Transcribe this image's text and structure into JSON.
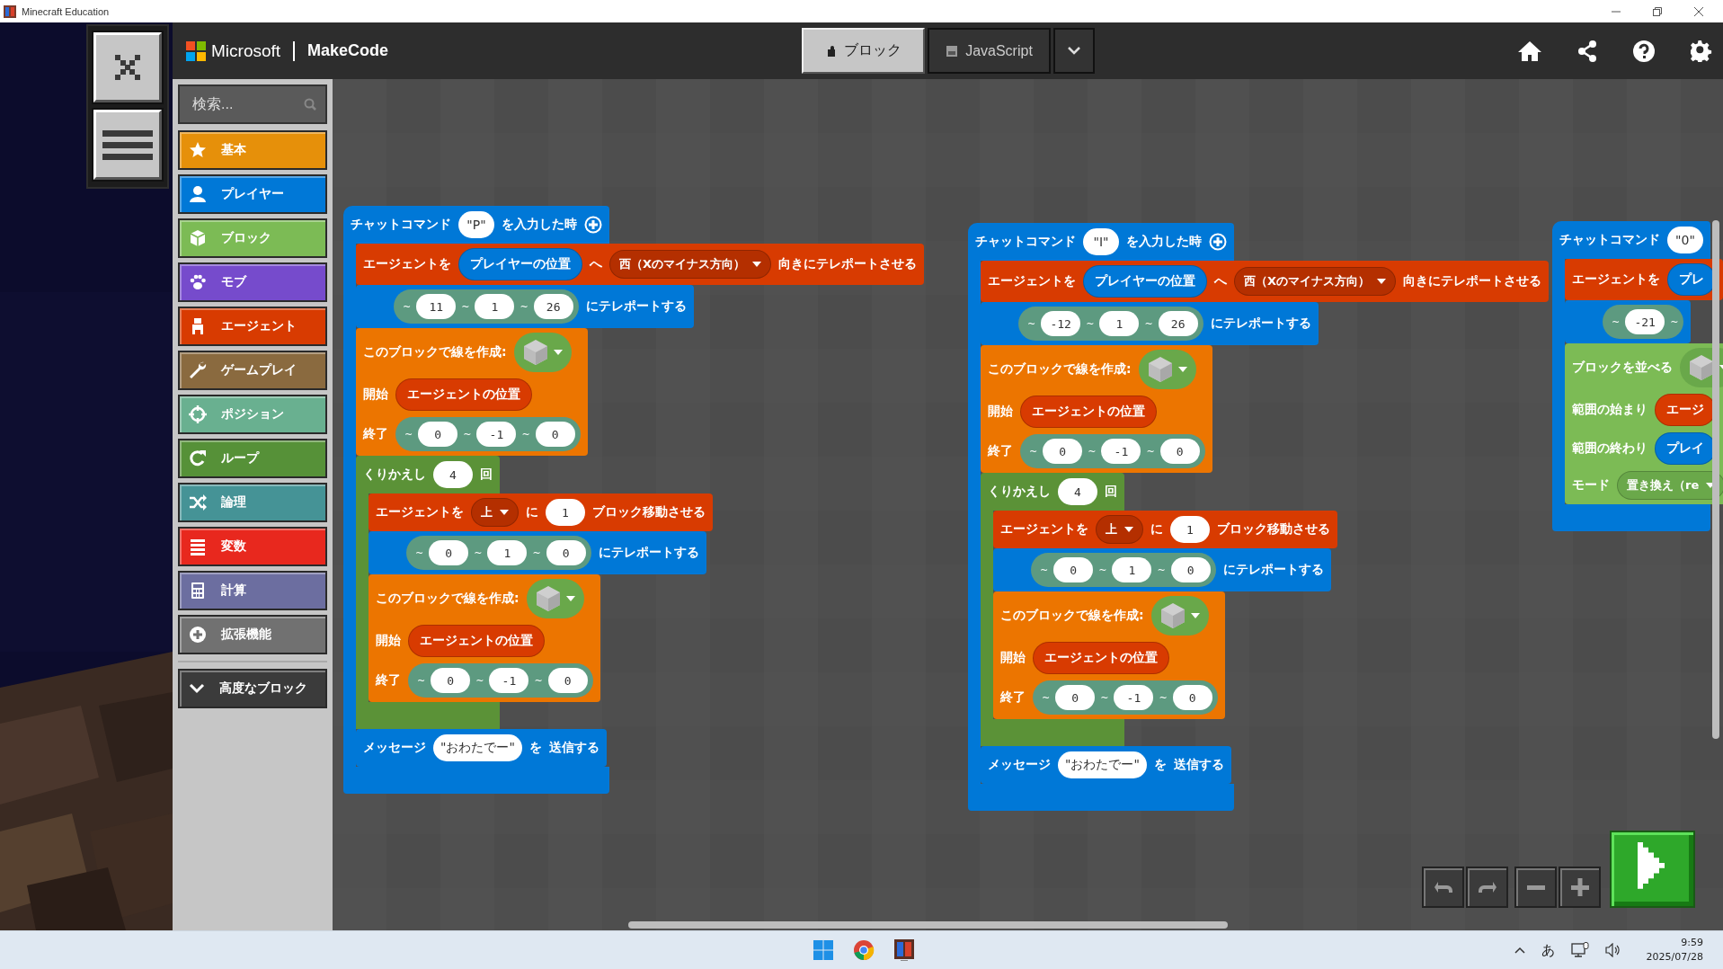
{
  "window": {
    "title": "Minecraft Education"
  },
  "header": {
    "brand": "Microsoft",
    "product": "MakeCode",
    "tabs": [
      {
        "label": "ブロック",
        "selected": true
      },
      {
        "label": "JavaScript",
        "selected": false
      }
    ]
  },
  "toolbox": {
    "search": {
      "placeholder": "検索..."
    },
    "categories": [
      {
        "label": "基本",
        "color": "#e6900a"
      },
      {
        "label": "プレイヤー",
        "color": "#0078d7"
      },
      {
        "label": "ブロック",
        "color": "#7cbb55"
      },
      {
        "label": "モブ",
        "color": "#764bcc"
      },
      {
        "label": "エージェント",
        "color": "#d83b01"
      },
      {
        "label": "ゲームプレイ",
        "color": "#8a6a3f"
      },
      {
        "label": "ポジション",
        "color": "#69b090"
      },
      {
        "label": "ループ",
        "color": "#569138"
      },
      {
        "label": "論理",
        "color": "#459396"
      },
      {
        "label": "変数",
        "color": "#e8281e"
      },
      {
        "label": "計算",
        "color": "#6c6ea0"
      },
      {
        "label": "拡張機能",
        "color": "#717171"
      }
    ],
    "advanced": {
      "label": "高度なブロック"
    }
  },
  "scripts": [
    {
      "kind": "event",
      "color": "#0078d7",
      "rows": [
        [
          {
            "kind": "text",
            "text": "チャットコマンド"
          },
          {
            "kind": "string",
            "text": "\"P\""
          },
          {
            "kind": "text",
            "text": "を入力した時"
          },
          {
            "kind": "plus"
          }
        ]
      ],
      "body": [
        {
          "kind": "statement",
          "color": "#d83b01",
          "rows": [
            [
              {
                "kind": "text",
                "text": "エージェントを"
              },
              {
                "kind": "pill",
                "color": "#0078d7",
                "text": "プレイヤーの位置"
              },
              {
                "kind": "text",
                "text": "へ"
              },
              {
                "kind": "dropdown",
                "color": "#b42f00",
                "text": "西（Xのマイナス方向）"
              },
              {
                "kind": "text",
                "text": "向きにテレポートさせる"
              }
            ]
          ]
        },
        {
          "kind": "statement",
          "color": "#0078d7",
          "rows": [
            [
              {
                "kind": "gap"
              },
              {
                "kind": "coords",
                "color": "#5d9a80",
                "parts": [
                  {
                    "kind": "tilde",
                    "text": "~"
                  },
                  {
                    "kind": "num",
                    "text": "11"
                  },
                  {
                    "kind": "tilde",
                    "text": "~"
                  },
                  {
                    "kind": "num",
                    "text": "1"
                  },
                  {
                    "kind": "tilde",
                    "text": "~"
                  },
                  {
                    "kind": "num",
                    "text": "26"
                  }
                ]
              },
              {
                "kind": "text",
                "text": "にテレポートする"
              }
            ]
          ]
        },
        {
          "kind": "statement",
          "color": "#ec7500",
          "rows": [
            [
              {
                "kind": "text",
                "text": "このブロックで線を作成:"
              },
              {
                "kind": "picker",
                "color": "#69a84a"
              }
            ],
            [
              {
                "kind": "text",
                "text": "開始"
              },
              {
                "kind": "pill",
                "color": "#d83b01",
                "text": "エージェントの位置"
              }
            ],
            [
              {
                "kind": "text",
                "text": "終了"
              },
              {
                "kind": "coords",
                "color": "#5d9a80",
                "parts": [
                  {
                    "kind": "tilde",
                    "text": "~"
                  },
                  {
                    "kind": "num",
                    "text": "0"
                  },
                  {
                    "kind": "tilde",
                    "text": "~"
                  },
                  {
                    "kind": "num",
                    "text": "-1"
                  },
                  {
                    "kind": "tilde",
                    "text": "~"
                  },
                  {
                    "kind": "num",
                    "text": "0"
                  }
                ]
              }
            ]
          ]
        },
        {
          "kind": "loop",
          "color": "#5b9237",
          "rows": [
            [
              {
                "kind": "text",
                "text": "くりかえし"
              },
              {
                "kind": "num",
                "text": "4"
              },
              {
                "kind": "text",
                "text": "回"
              }
            ]
          ],
          "body": [
            {
              "kind": "statement",
              "color": "#d83b01",
              "rows": [
                [
                  {
                    "kind": "text",
                    "text": "エージェントを"
                  },
                  {
                    "kind": "dropdown",
                    "color": "#b42f00",
                    "text": "上"
                  },
                  {
                    "kind": "text",
                    "text": "に"
                  },
                  {
                    "kind": "num",
                    "text": "1"
                  },
                  {
                    "kind": "text",
                    "text": "ブロック移動させる"
                  }
                ]
              ]
            },
            {
              "kind": "statement",
              "color": "#0078d7",
              "rows": [
                [
                  {
                    "kind": "gap"
                  },
                  {
                    "kind": "coords",
                    "color": "#5d9a80",
                    "parts": [
                      {
                        "kind": "tilde",
                        "text": "~"
                      },
                      {
                        "kind": "num",
                        "text": "0"
                      },
                      {
                        "kind": "tilde",
                        "text": "~"
                      },
                      {
                        "kind": "num",
                        "text": "1"
                      },
                      {
                        "kind": "tilde",
                        "text": "~"
                      },
                      {
                        "kind": "num",
                        "text": "0"
                      }
                    ]
                  },
                  {
                    "kind": "text",
                    "text": "にテレポートする"
                  }
                ]
              ]
            },
            {
              "kind": "statement",
              "color": "#ec7500",
              "rows": [
                [
                  {
                    "kind": "text",
                    "text": "このブロックで線を作成:"
                  },
                  {
                    "kind": "picker",
                    "color": "#69a84a"
                  }
                ],
                [
                  {
                    "kind": "text",
                    "text": "開始"
                  },
                  {
                    "kind": "pill",
                    "color": "#d83b01",
                    "text": "エージェントの位置"
                  }
                ],
                [
                  {
                    "kind": "text",
                    "text": "終了"
                  },
                  {
                    "kind": "coords",
                    "color": "#5d9a80",
                    "parts": [
                      {
                        "kind": "tilde",
                        "text": "~"
                      },
                      {
                        "kind": "num",
                        "text": "0"
                      },
                      {
                        "kind": "tilde",
                        "text": "~"
                      },
                      {
                        "kind": "num",
                        "text": "-1"
                      },
                      {
                        "kind": "tilde",
                        "text": "~"
                      },
                      {
                        "kind": "num",
                        "text": "0"
                      }
                    ]
                  }
                ]
              ]
            }
          ]
        },
        {
          "kind": "statement",
          "color": "#0078d7",
          "rows": [
            [
              {
                "kind": "text",
                "text": "メッセージ"
              },
              {
                "kind": "string",
                "text": "\"おわたでー\""
              },
              {
                "kind": "text",
                "text": "を"
              },
              {
                "kind": "text",
                "text": "送信する"
              }
            ]
          ]
        }
      ]
    },
    {
      "kind": "event",
      "color": "#0078d7",
      "rows": [
        [
          {
            "kind": "text",
            "text": "チャットコマンド"
          },
          {
            "kind": "string",
            "text": "\"I\""
          },
          {
            "kind": "text",
            "text": "を入力した時"
          },
          {
            "kind": "plus"
          }
        ]
      ],
      "body": [
        {
          "kind": "statement",
          "color": "#d83b01",
          "rows": [
            [
              {
                "kind": "text",
                "text": "エージェントを"
              },
              {
                "kind": "pill",
                "color": "#0078d7",
                "text": "プレイヤーの位置"
              },
              {
                "kind": "text",
                "text": "へ"
              },
              {
                "kind": "dropdown",
                "color": "#b42f00",
                "text": "西（Xのマイナス方向）"
              },
              {
                "kind": "text",
                "text": "向きにテレポートさせる"
              }
            ]
          ]
        },
        {
          "kind": "statement",
          "color": "#0078d7",
          "rows": [
            [
              {
                "kind": "gap"
              },
              {
                "kind": "coords",
                "color": "#5d9a80",
                "parts": [
                  {
                    "kind": "tilde",
                    "text": "~"
                  },
                  {
                    "kind": "num",
                    "text": "-12"
                  },
                  {
                    "kind": "tilde",
                    "text": "~"
                  },
                  {
                    "kind": "num",
                    "text": "1"
                  },
                  {
                    "kind": "tilde",
                    "text": "~"
                  },
                  {
                    "kind": "num",
                    "text": "26"
                  }
                ]
              },
              {
                "kind": "text",
                "text": "にテレポートする"
              }
            ]
          ]
        },
        {
          "kind": "statement",
          "color": "#ec7500",
          "rows": [
            [
              {
                "kind": "text",
                "text": "このブロックで線を作成:"
              },
              {
                "kind": "picker",
                "color": "#69a84a"
              }
            ],
            [
              {
                "kind": "text",
                "text": "開始"
              },
              {
                "kind": "pill",
                "color": "#d83b01",
                "text": "エージェントの位置"
              }
            ],
            [
              {
                "kind": "text",
                "text": "終了"
              },
              {
                "kind": "coords",
                "color": "#5d9a80",
                "parts": [
                  {
                    "kind": "tilde",
                    "text": "~"
                  },
                  {
                    "kind": "num",
                    "text": "0"
                  },
                  {
                    "kind": "tilde",
                    "text": "~"
                  },
                  {
                    "kind": "num",
                    "text": "-1"
                  },
                  {
                    "kind": "tilde",
                    "text": "~"
                  },
                  {
                    "kind": "num",
                    "text": "0"
                  }
                ]
              }
            ]
          ]
        },
        {
          "kind": "loop",
          "color": "#5b9237",
          "rows": [
            [
              {
                "kind": "text",
                "text": "くりかえし"
              },
              {
                "kind": "num",
                "text": "4"
              },
              {
                "kind": "text",
                "text": "回"
              }
            ]
          ],
          "body": [
            {
              "kind": "statement",
              "color": "#d83b01",
              "rows": [
                [
                  {
                    "kind": "text",
                    "text": "エージェントを"
                  },
                  {
                    "kind": "dropdown",
                    "color": "#b42f00",
                    "text": "上"
                  },
                  {
                    "kind": "text",
                    "text": "に"
                  },
                  {
                    "kind": "num",
                    "text": "1"
                  },
                  {
                    "kind": "text",
                    "text": "ブロック移動させる"
                  }
                ]
              ]
            },
            {
              "kind": "statement",
              "color": "#0078d7",
              "rows": [
                [
                  {
                    "kind": "gap"
                  },
                  {
                    "kind": "coords",
                    "color": "#5d9a80",
                    "parts": [
                      {
                        "kind": "tilde",
                        "text": "~"
                      },
                      {
                        "kind": "num",
                        "text": "0"
                      },
                      {
                        "kind": "tilde",
                        "text": "~"
                      },
                      {
                        "kind": "num",
                        "text": "1"
                      },
                      {
                        "kind": "tilde",
                        "text": "~"
                      },
                      {
                        "kind": "num",
                        "text": "0"
                      }
                    ]
                  },
                  {
                    "kind": "text",
                    "text": "にテレポートする"
                  }
                ]
              ]
            },
            {
              "kind": "statement",
              "color": "#ec7500",
              "rows": [
                [
                  {
                    "kind": "text",
                    "text": "このブロックで線を作成:"
                  },
                  {
                    "kind": "picker",
                    "color": "#69a84a"
                  }
                ],
                [
                  {
                    "kind": "text",
                    "text": "開始"
                  },
                  {
                    "kind": "pill",
                    "color": "#d83b01",
                    "text": "エージェントの位置"
                  }
                ],
                [
                  {
                    "kind": "text",
                    "text": "終了"
                  },
                  {
                    "kind": "coords",
                    "color": "#5d9a80",
                    "parts": [
                      {
                        "kind": "tilde",
                        "text": "~"
                      },
                      {
                        "kind": "num",
                        "text": "0"
                      },
                      {
                        "kind": "tilde",
                        "text": "~"
                      },
                      {
                        "kind": "num",
                        "text": "-1"
                      },
                      {
                        "kind": "tilde",
                        "text": "~"
                      },
                      {
                        "kind": "num",
                        "text": "0"
                      }
                    ]
                  }
                ]
              ]
            }
          ]
        },
        {
          "kind": "statement",
          "color": "#0078d7",
          "rows": [
            [
              {
                "kind": "text",
                "text": "メッセージ"
              },
              {
                "kind": "string",
                "text": "\"おわたでー\""
              },
              {
                "kind": "text",
                "text": "を"
              },
              {
                "kind": "text",
                "text": "送信する"
              }
            ]
          ]
        }
      ]
    },
    {
      "kind": "event",
      "color": "#0078d7",
      "rows": [
        [
          {
            "kind": "text",
            "text": "チャットコマンド"
          },
          {
            "kind": "string",
            "text": "\"0\""
          }
        ]
      ],
      "body": [
        {
          "kind": "statement",
          "color": "#d83b01",
          "rows": [
            [
              {
                "kind": "text",
                "text": "エージェントを"
              },
              {
                "kind": "pill",
                "color": "#0078d7",
                "text": "プレ"
              }
            ]
          ]
        },
        {
          "kind": "statement",
          "color": "#0078d7",
          "rows": [
            [
              {
                "kind": "gap"
              },
              {
                "kind": "coords",
                "color": "#5d9a80",
                "parts": [
                  {
                    "kind": "tilde",
                    "text": "~"
                  },
                  {
                    "kind": "num",
                    "text": "-21"
                  },
                  {
                    "kind": "tilde",
                    "text": "~"
                  }
                ]
              }
            ]
          ]
        },
        {
          "kind": "statement",
          "color": "#7cbb55",
          "rows": [
            [
              {
                "kind": "text",
                "text": "ブロックを並べる"
              },
              {
                "kind": "picker",
                "color": "#69a84a"
              }
            ],
            [
              {
                "kind": "text",
                "text": "範囲の始まり"
              },
              {
                "kind": "pill",
                "color": "#d83b01",
                "text": "エージ"
              }
            ],
            [
              {
                "kind": "text",
                "text": "範囲の終わり"
              },
              {
                "kind": "pill",
                "color": "#0078d7",
                "text": "プレイ"
              }
            ],
            [
              {
                "kind": "text",
                "text": "モード"
              },
              {
                "kind": "dropdown",
                "color": "#6aa84a",
                "text": "置き換え（re"
              }
            ]
          ]
        }
      ]
    }
  ],
  "taskbar": {
    "ime": "あ",
    "time": "9:59",
    "date": "2025/07/28"
  }
}
